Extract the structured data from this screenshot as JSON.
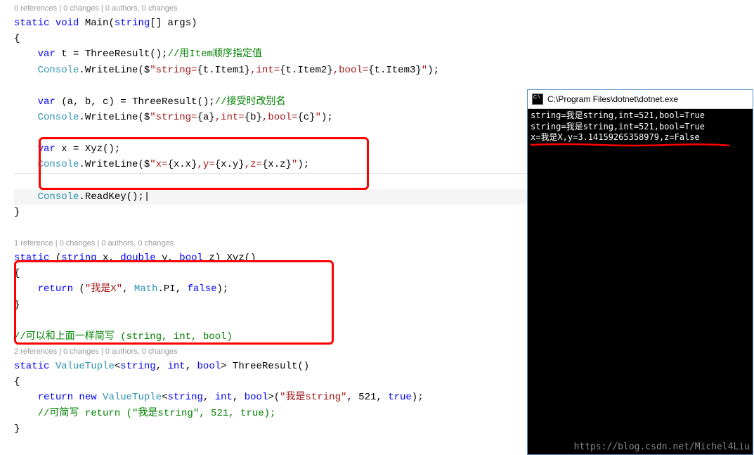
{
  "codelens": {
    "main": "0 references | 0 changes | 0 authors, 0 changes",
    "xyz": "1 reference | 0 changes | 0 authors, 0 changes",
    "three": "2 references | 0 changes | 0 authors, 0 changes"
  },
  "code": {
    "main_sig_static": "static",
    "main_sig_void": "void",
    "main_sig_name": " Main(",
    "main_sig_string": "string",
    "main_sig_args": "[] args)",
    "brace_open": "{",
    "brace_close": "}",
    "line_t_var": "var",
    "line_t_rest": " t = ThreeResult();",
    "line_t_comment": "//用Item顺序指定值",
    "line_wl1_console": "Console",
    "line_wl1_dot": ".WriteLine($",
    "line_wl1_str1": "\"string=",
    "line_wl1_item1": "{t.Item1}",
    "line_wl1_str2": ",int=",
    "line_wl1_item2": "{t.Item2}",
    "line_wl1_str3": ",bool=",
    "line_wl1_item3": "{t.Item3}",
    "line_wl1_end": "\"",
    "line_wl1_paren": ");",
    "line_abc_var": "var",
    "line_abc_rest": " (a, b, c) = ThreeResult();",
    "line_abc_comment": "//接受时改别名",
    "line_wl2_str1": "\"string=",
    "line_wl2_a": "{a}",
    "line_wl2_str2": ",int=",
    "line_wl2_b": "{b}",
    "line_wl2_str3": ",bool=",
    "line_wl2_c": "{c}",
    "line_x_var": "var",
    "line_x_rest": " x = Xyz();",
    "line_wl3_str1": "\"x=",
    "line_wl3_xx": "{x.x}",
    "line_wl3_str2": ",y=",
    "line_wl3_xy": "{x.y}",
    "line_wl3_str3": ",z=",
    "line_wl3_xz": "{x.z}",
    "line_readkey": ".ReadKey();",
    "xyz_sig_static": "static",
    "xyz_sig_paren1": " (",
    "xyz_sig_string": "string",
    "xyz_sig_x": " x, ",
    "xyz_sig_double": "double",
    "xyz_sig_y": " y, ",
    "xyz_sig_bool": "bool",
    "xyz_sig_z": " z) Xyz()",
    "xyz_return": "return",
    "xyz_ret_paren": " (",
    "xyz_ret_str": "\"我是X\"",
    "xyz_ret_comma1": ", ",
    "xyz_ret_math": "Math",
    "xyz_ret_pi": ".PI, ",
    "xyz_ret_false": "false",
    "xyz_ret_end": ");",
    "comment_simplify": "//可以和上面一样简写 (string, int, bool)",
    "three_sig_static": "static",
    "three_sig_vt": "ValueTuple",
    "three_sig_lt": "<",
    "three_sig_string": "string",
    "three_sig_c1": ", ",
    "three_sig_int": "int",
    "three_sig_c2": ", ",
    "three_sig_bool": "bool",
    "three_sig_gt": "> ThreeResult()",
    "three_return": "return",
    "three_new": " new",
    "three_ret_str": "\"我是string\"",
    "three_ret_args": ", 521, ",
    "three_ret_true": "true",
    "three_ret_end": ");",
    "three_comment": "//可简写 return (\"我是string\", 521, true);"
  },
  "console": {
    "title": "C:\\Program Files\\dotnet\\dotnet.exe",
    "line1": "string=我是string,int=521,bool=True",
    "line2": "string=我是string,int=521,bool=True",
    "line3": "x=我是X,y=3.14159265358979,z=False"
  },
  "watermark": "https://blog.csdn.net/Michel4Liu"
}
